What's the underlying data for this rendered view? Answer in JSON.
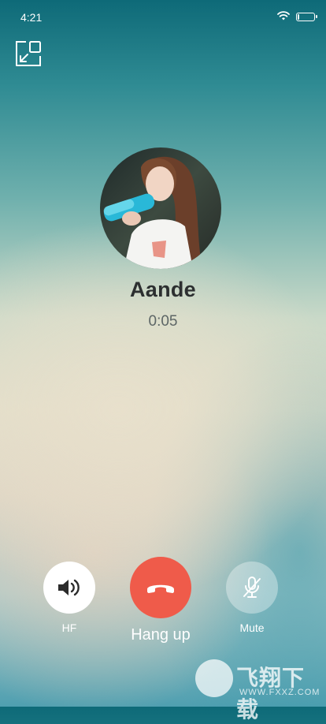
{
  "status_bar": {
    "time": "4:21",
    "battery_level": 0.1
  },
  "caller": {
    "name": "Aande",
    "duration": "0:05"
  },
  "controls": {
    "hf": {
      "label": "HF",
      "icon": "speaker-icon"
    },
    "hangup": {
      "label": "Hang up",
      "icon": "hangup-phone-icon",
      "color": "#ef5b4a"
    },
    "mute": {
      "label": "Mute",
      "icon": "microphone-muted-icon"
    }
  },
  "top_bar": {
    "minimize_icon": "minimize-window-icon"
  },
  "watermark": {
    "text": "飞翔下载",
    "url": "WWW.FXXZ.COM"
  }
}
